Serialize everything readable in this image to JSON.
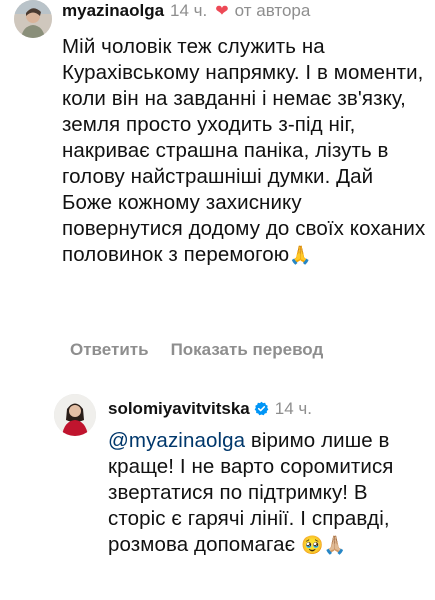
{
  "comment1": {
    "username": "myazinaolga",
    "time": "14 ч.",
    "heart_icon": "heart-icon",
    "by_author": "от автора",
    "text": "Мій чоловік теж служить на Курахівському напрямку. І в моменти, коли він на завданні і немає зв'язку, земля просто уходить з-під ніг, накриває страшна паніка, лізуть в голову найстрашніші думки. Дай Боже кожному захиснику повернутися додому до своїх коханих половинок з перемогою",
    "emoji": "🙏",
    "reply_label": "Ответить",
    "translate_label": "Показать перевод"
  },
  "comment2": {
    "username": "solomiyavitvitska",
    "verified_icon": "verified-badge-icon",
    "time": "14 ч.",
    "mention": "@myazinaolga",
    "text": " віримо лише в краще! І не варто соромитися звертатися по підтримку! В сторіс є гарячі лінії. І справді, розмова допомагає ",
    "emoji": "🥹🙏🏼"
  },
  "colors": {
    "username": "#111111",
    "secondary": "#8e8e8e",
    "heart": "#ed4956",
    "mention": "#00376b",
    "verified": "#0095f6"
  }
}
